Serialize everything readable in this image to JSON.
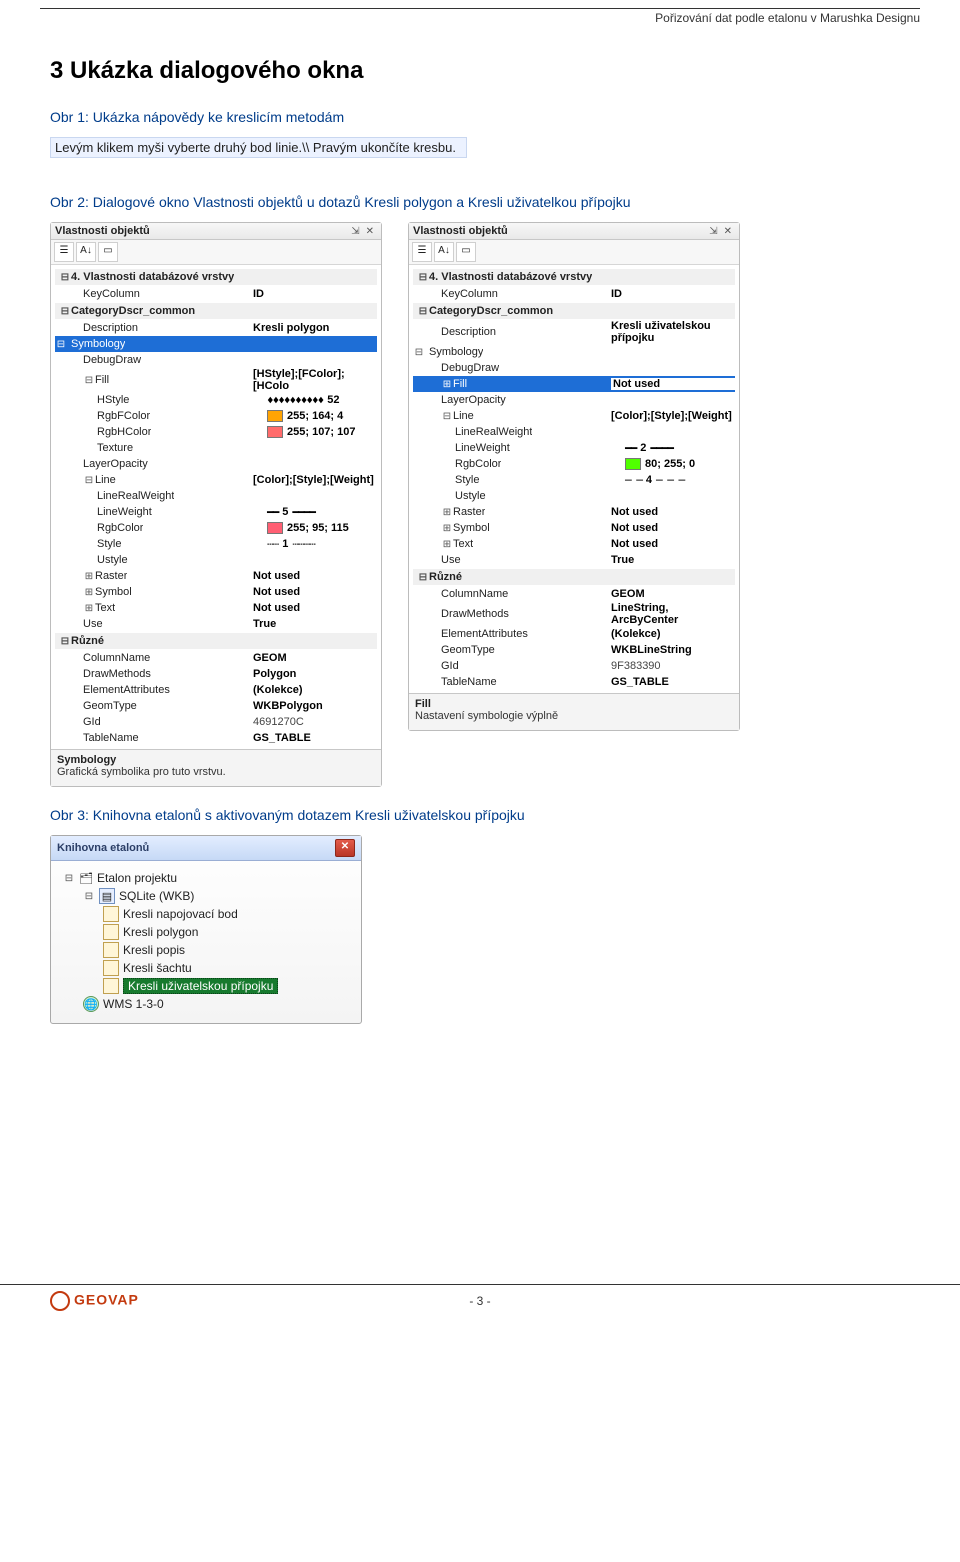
{
  "header": {
    "text": "Pořizování dat podle etalonu v Marushka Designu"
  },
  "doc": {
    "h1": "3   Ukázka dialogového okna",
    "caption1": "Obr 1: Ukázka nápovědy ke kreslicím metodám",
    "hint": "Levým klikem myši vyberte druhý bod linie.\\\\ Pravým ukončíte kresbu.",
    "caption2": "Obr 2: Dialogové okno Vlastnosti objektů u dotazů Kresli polygon a Kresli uživatelkou přípojku",
    "caption3": "Obr 3: Knihovna etalonů s aktivovaným dotazem Kresli uživatelskou přípojku"
  },
  "panels": {
    "title": "Vlastnosti objektů",
    "left": {
      "section4": "4. Vlastnosti databázové vrstvy",
      "keycol_l": "KeyColumn",
      "keycol_v": "ID",
      "catdscr": "CategoryDscr_common",
      "desc_l": "Description",
      "desc_v": "Kresli polygon",
      "symbology": "Symbology",
      "debug": "DebugDraw",
      "fill_l": "Fill",
      "fill_v": "[HStyle];[FColor];[HColo",
      "hstyle_l": "HStyle",
      "hstyle_v": "52",
      "hstyle_pat": "♦♦♦♦♦♦♦♦♦♦",
      "rgbF_l": "RgbFColor",
      "rgbF_v": "255; 164; 4",
      "rgbH_l": "RgbHColor",
      "rgbH_v": "255; 107; 107",
      "texture": "Texture",
      "layerop": "LayerOpacity",
      "line_l": "Line",
      "line_v": "[Color];[Style];[Weight]",
      "lrw": "LineRealWeight",
      "lw_l": "LineWeight",
      "lw_v": "5",
      "rgbc_l": "RgbColor",
      "rgbc_v": "255; 95; 115",
      "style_l": "Style",
      "style_v": "1",
      "ustyle": "Ustyle",
      "raster_l": "Raster",
      "raster_v": "Not used",
      "symbol_l": "Symbol",
      "symbol_v": "Not used",
      "text_l": "Text",
      "text_v": "Not used",
      "use_l": "Use",
      "use_v": "True",
      "misc": "Různé",
      "coln_l": "ColumnName",
      "coln_v": "GEOM",
      "dm_l": "DrawMethods",
      "dm_v": "Polygon",
      "ea_l": "ElementAttributes",
      "ea_v": "(Kolekce)",
      "gt_l": "GeomType",
      "gt_v": "WKBPolygon",
      "gid_l": "GId",
      "gid_v": "4691270C",
      "tn_l": "TableName",
      "tn_v": "GS_TABLE",
      "help_t": "Symbology",
      "help_d": "Grafická symbolika pro tuto vrstvu."
    },
    "right": {
      "section4": "4. Vlastnosti databázové vrstvy",
      "keycol_l": "KeyColumn",
      "keycol_v": "ID",
      "catdscr": "CategoryDscr_common",
      "desc_l": "Description",
      "desc_v": "Kresli uživatelskou přípojku",
      "symbology": "Symbology",
      "debug": "DebugDraw",
      "fill_l": "Fill",
      "fill_v": "Not used",
      "layerop": "LayerOpacity",
      "line_l": "Line",
      "line_v": "[Color];[Style];[Weight]",
      "lrw": "LineRealWeight",
      "lw_l": "LineWeight",
      "lw_v": "2",
      "rgbc_l": "RgbColor",
      "rgbc_v": "80; 255; 0",
      "style_l": "Style",
      "style_v": "4",
      "ustyle": "Ustyle",
      "raster_l": "Raster",
      "raster_v": "Not used",
      "symbol_l": "Symbol",
      "symbol_v": "Not used",
      "text_l": "Text",
      "text_v": "Not used",
      "use_l": "Use",
      "use_v": "True",
      "misc": "Různé",
      "coln_l": "ColumnName",
      "coln_v": "GEOM",
      "dm_l": "DrawMethods",
      "dm_v": "LineString, ArcByCenter",
      "ea_l": "ElementAttributes",
      "ea_v": "(Kolekce)",
      "gt_l": "GeomType",
      "gt_v": "WKBLineString",
      "gid_l": "GId",
      "gid_v": "9F383390",
      "tn_l": "TableName",
      "tn_v": "GS_TABLE",
      "help_t": "Fill",
      "help_d": "Nastavení symbologie výplně"
    }
  },
  "etalon": {
    "wintitle": "Knihovna etalonů",
    "nodes": {
      "root": "Etalon projektu",
      "db": "SQLite (WKB)",
      "i1": "Kresli napojovací bod",
      "i2": "Kresli polygon",
      "i3": "Kresli popis",
      "i4": "Kresli šachtu",
      "i5": "Kresli uživatelskou přípojku",
      "wms": "WMS 1-3-0"
    }
  },
  "footer": {
    "logo": "GEOVAP",
    "pagenum": "- 3 -"
  }
}
